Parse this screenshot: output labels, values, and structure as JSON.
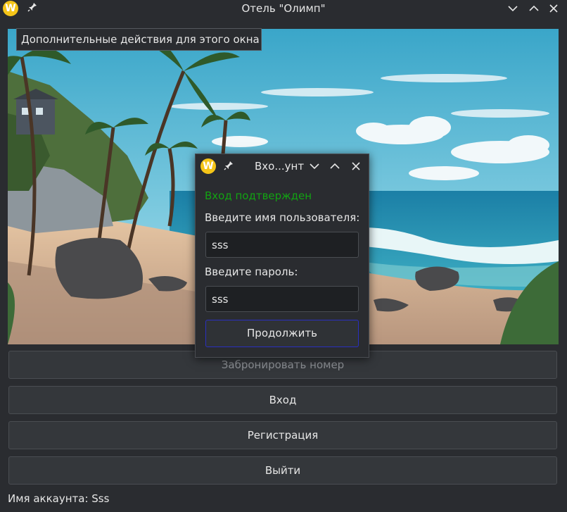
{
  "window": {
    "title": "Отель \"Олимп\"",
    "logo_letter": "W",
    "tooltip": "Дополнительные действия для этого окна"
  },
  "main": {
    "buttons": {
      "book": "Забронировать номер",
      "login": "Вход",
      "register": "Регистрация",
      "exit": "Выйти"
    },
    "account_label": "Имя аккаунта: Sss"
  },
  "dialog": {
    "title": "Вхо...унт",
    "logo_letter": "W",
    "status": "Вход подтвержден",
    "username_label": "Введите имя пользователя:",
    "username_value": "sss",
    "password_label": "Введите пароль:",
    "password_value": "sss",
    "continue": "Продолжить"
  },
  "colors": {
    "status_green": "#12a312",
    "focus_border": "#2a2fc0",
    "logo_yellow": "#f5c518"
  }
}
